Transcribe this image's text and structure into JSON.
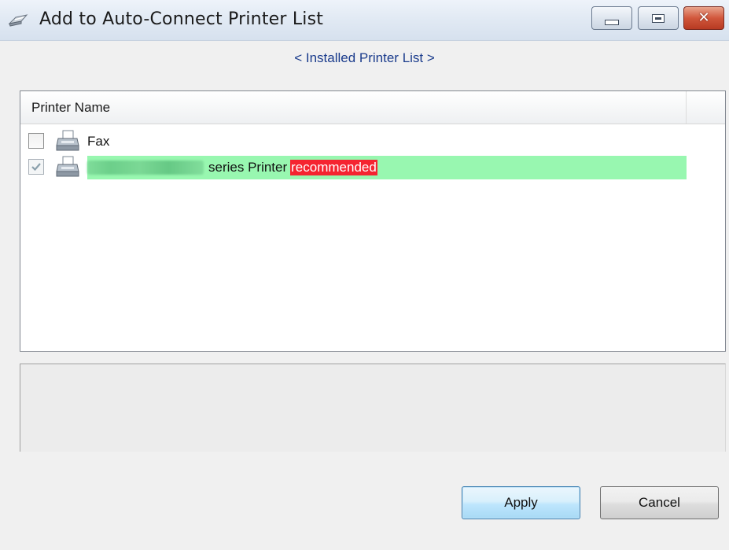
{
  "window": {
    "title": "Add to Auto-Connect Printer List"
  },
  "heading": "< Installed Printer List >",
  "list": {
    "column_header": "Printer Name",
    "rows": [
      {
        "label": "Fax",
        "checked": false,
        "icon": "printer-icon"
      },
      {
        "label_suffix": "series Printer",
        "badge": "recommended",
        "checked": true,
        "highlighted": true,
        "icon": "printer-icon"
      }
    ]
  },
  "buttons": {
    "apply": "Apply",
    "cancel": "Cancel"
  },
  "colors": {
    "row_highlight": "#98f7b0",
    "recommended_badge": "#f52430",
    "heading_text": "#1a3b8c"
  }
}
